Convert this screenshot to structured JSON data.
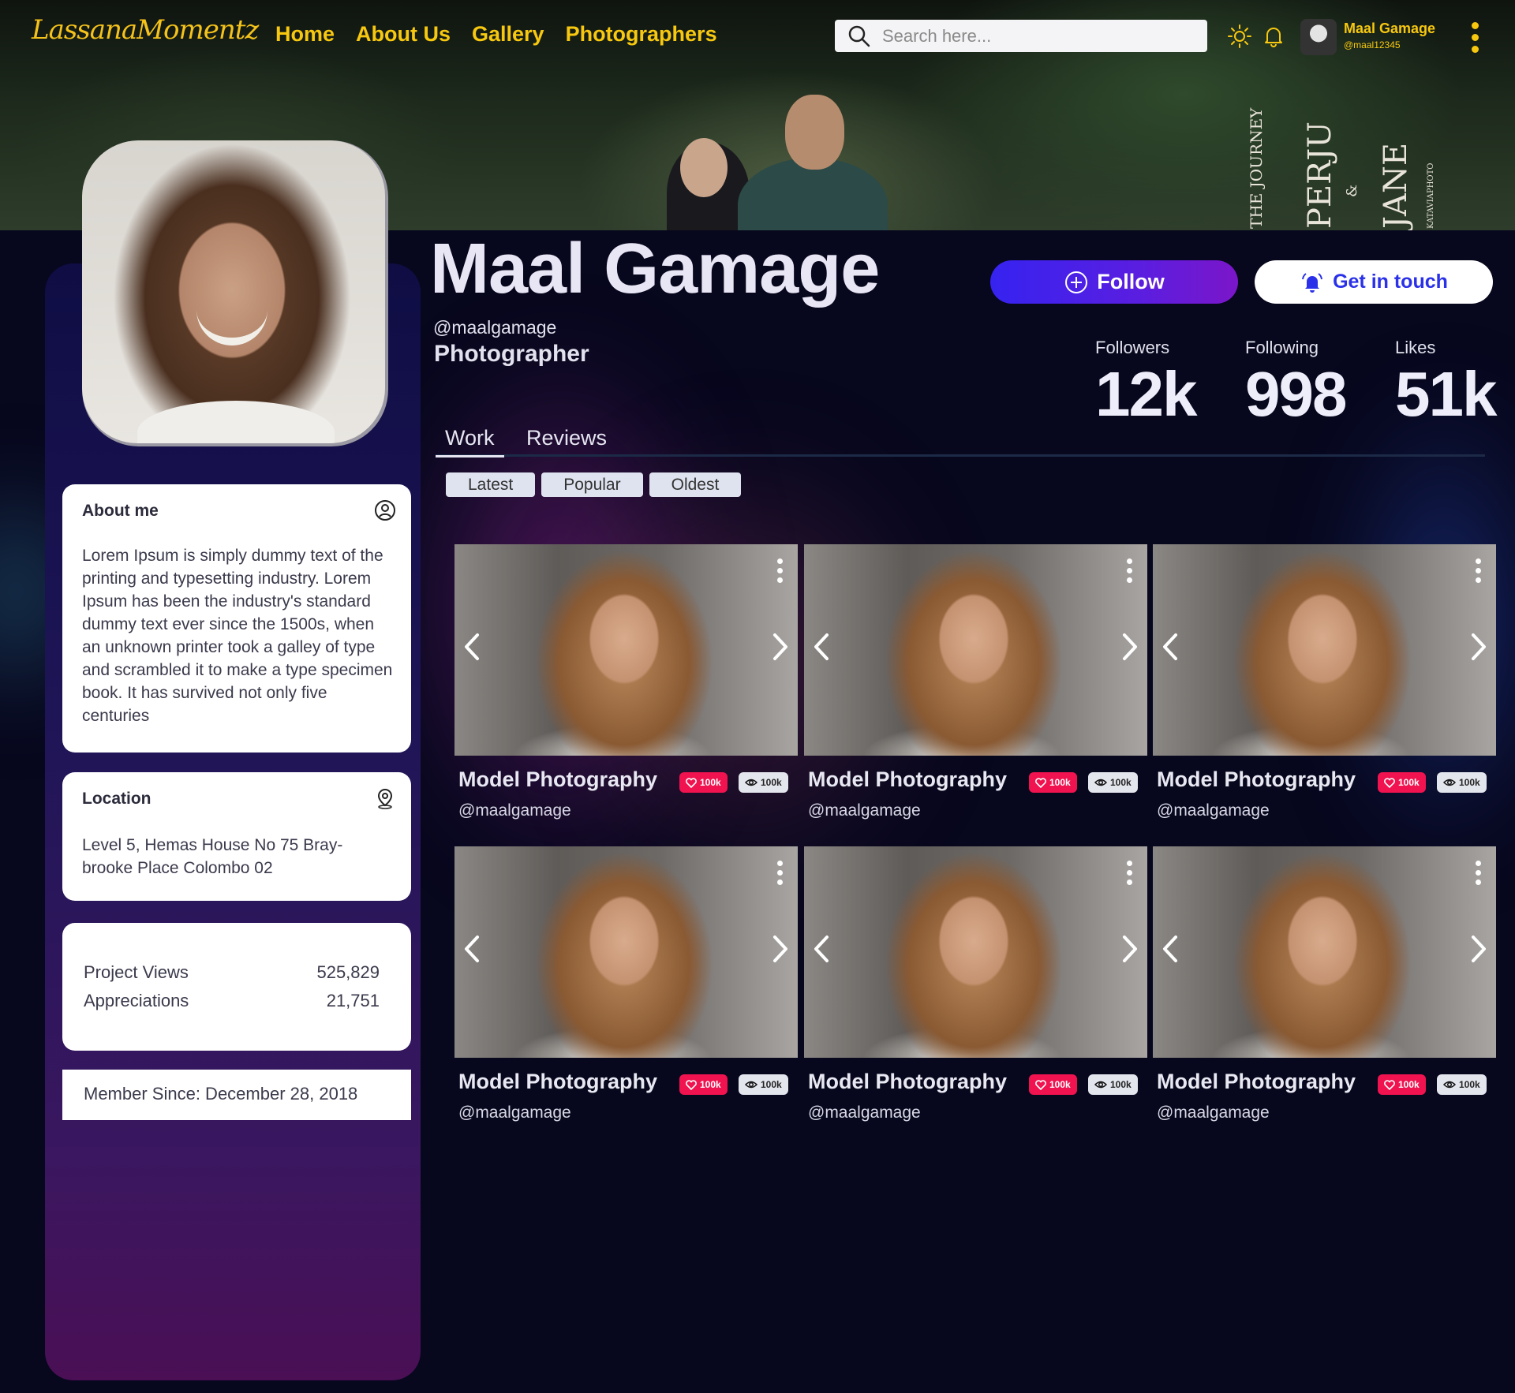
{
  "app": {
    "logo_text": "LassanaMomentz"
  },
  "nav": {
    "items": [
      "Home",
      "About Us",
      "Gallery",
      "Photographers"
    ]
  },
  "search": {
    "placeholder": "Search here..."
  },
  "user": {
    "name": "Maal Gamage",
    "handle": "@maal12345"
  },
  "cover": {
    "text1": "THE JOURNEY",
    "text2": "PERJU",
    "text3": "&",
    "text4": "JANE",
    "text5": "KATAVIAPHOTO"
  },
  "profile": {
    "name": "Maal Gamage",
    "handle": "@maalgamage",
    "role": "Photographer",
    "follow_label": "Follow",
    "contact_label": "Get in touch",
    "stats": {
      "followers_label": "Followers",
      "followers": "12k",
      "following_label": "Following",
      "following": "998",
      "likes_label": "Likes",
      "likes": "51k"
    }
  },
  "about": {
    "title": "About me",
    "text": "Lorem Ipsum is simply dummy text of the printing and typesetting industry. Lorem Ipsum has been the industry's standard dummy text ever since the 1500s, when an unknown printer took a galley of type and scrambled it to make a type specimen book. It has survived not only five centuries"
  },
  "location": {
    "title": "Location",
    "text": "Level 5, Hemas House No 75 Bray-brooke Place Colombo 02"
  },
  "project_stats": {
    "views_label": "Project Views",
    "views": "525,829",
    "appreciations_label": "Appreciations",
    "appreciations": "21,751"
  },
  "member_since": "Member Since: December 28, 2018",
  "tabs": [
    "Work",
    "Reviews"
  ],
  "filters": [
    "Latest",
    "Popular",
    "Oldest"
  ],
  "gallery": [
    {
      "title": "Model Photography",
      "author": "@maalgamage",
      "likes": "100k",
      "views": "100k"
    },
    {
      "title": "Model Photography",
      "author": "@maalgamage",
      "likes": "100k",
      "views": "100k"
    },
    {
      "title": "Model Photography",
      "author": "@maalgamage",
      "likes": "100k",
      "views": "100k"
    },
    {
      "title": "Model Photography",
      "author": "@maalgamage",
      "likes": "100k",
      "views": "100k"
    },
    {
      "title": "Model Photography",
      "author": "@maalgamage",
      "likes": "100k",
      "views": "100k"
    },
    {
      "title": "Model Photography",
      "author": "@maalgamage",
      "likes": "100k",
      "views": "100k"
    }
  ],
  "colors": {
    "accent_yellow": "#f7c80f",
    "follow_gradient_start": "#3623f0",
    "follow_gradient_end": "#7b16c9",
    "like_badge": "#f0134f",
    "page_bg": "#07071d"
  }
}
